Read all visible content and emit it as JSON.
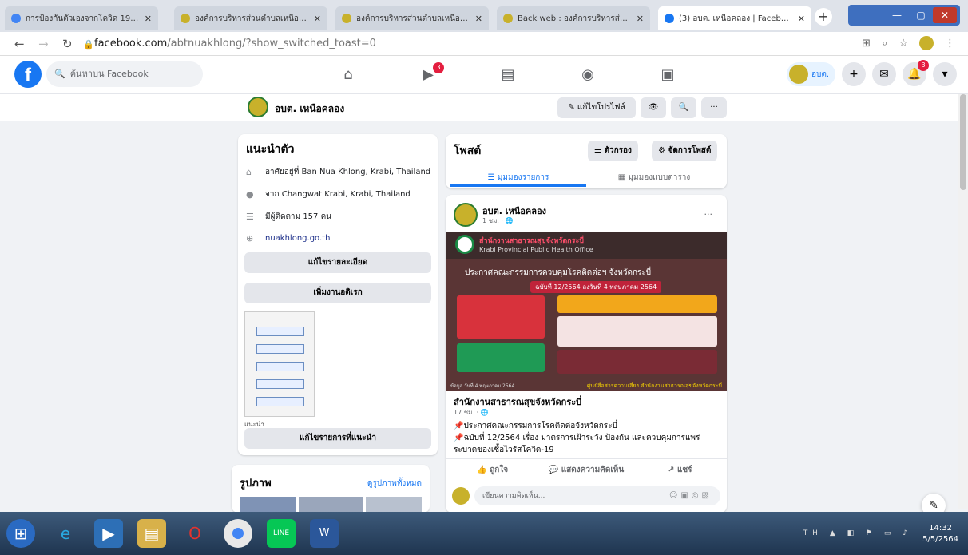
{
  "browser": {
    "tabs": [
      {
        "title": "การป้องกันตัวเองจากโควิด 19 - Go",
        "icon_color": "#4285f4"
      },
      {
        "title": "องค์การบริหารส่วนตำบลเหนือคลอง",
        "icon_color": "#c8b12b"
      },
      {
        "title": "องค์การบริหารส่วนตำบลเหนือคลอง",
        "icon_color": "#c8b12b"
      },
      {
        "title": "Back web : องค์การบริหารส่วนตำ",
        "icon_color": "#c8b12b"
      },
      {
        "title": "(3) อบต. เหนือคลอง | Facebook",
        "icon_color": "#1877f2"
      }
    ],
    "url_host": "facebook.com",
    "url_path": "/abtnuakhlong/?show_switched_toast=0"
  },
  "fb": {
    "search_placeholder": "ค้นหาบน Facebook",
    "nav_badge": "3",
    "account_name": "อบต.",
    "notif_badge": "3"
  },
  "page": {
    "name": "อบต. เหนือคลอง",
    "edit_profile": "แก้ไขโปรไฟล์"
  },
  "intro": {
    "title": "แนะนำตัว",
    "lives_in": "อาศัยอยู่ที่ Ban Nua Khlong, Krabi, Thailand",
    "from": "จาก Changwat Krabi, Krabi, Thailand",
    "followers": "มีผู้ติดตาม 157 คน",
    "website": "nuakhlong.go.th",
    "edit_details": "แก้ไขรายละเอียด",
    "add_hobbies": "เพิ่มงานอดิเรก",
    "featured_label": "แนะนำ",
    "edit_featured": "แก้ไขรายการที่แนะนำ"
  },
  "photos": {
    "title": "รูปภาพ",
    "see_all": "ดูรูปภาพทั้งหมด"
  },
  "posts": {
    "title": "โพสต์",
    "filter": "ตัวกรอง",
    "manage": "จัดการโพสต์",
    "list_view": "มุมมองรายการ",
    "grid_view": "มุมมองแบบตาราง"
  },
  "post": {
    "author": "อบต. เหนือคลอง",
    "time": "1 ชม. · 🌐",
    "poster_org_th": "สำนักงานสาธารณสุขจังหวัดกระบี่",
    "poster_org_en": "Krabi Provincial Public Health Office",
    "poster_headline": "ประกาศคณะกรรมการควบคุมโรคติดต่อฯ จังหวัดกระบี่",
    "poster_sub": "ฉบับที่ 12/2564 ลงวันที่ 4 พฤษภาคม 2564",
    "poster_date": "ข้อมูล วันที่ 4 พฤษภาคม 2564",
    "poster_footer": "ศูนย์สื่อสารความเสี่ยง สำนักงานสาธารณสุขจังหวัดกระบี่",
    "shared_from": "สำนักงานสาธารณสุขจังหวัดกระบี่",
    "shared_time": "17 ชม. · 🌐",
    "body_line1": "📌ประกาศคณะกรรมการโรคติดต่อจังหวัดกระบี่",
    "body_line2": "📌ฉบับที่ 12/2564 เรื่อง มาตรการเฝ้าระวัง ป้องกัน และควบคุมการแพร่ระบาดของเชื้อไวรัสโควิด-19",
    "like": "ถูกใจ",
    "comment": "แสดงความคิดเห็น",
    "share": "แชร์",
    "comment_placeholder": "เขียนความคิดเห็น..."
  },
  "taskbar": {
    "lang": "TH",
    "time": "14:32",
    "date": "5/5/2564"
  }
}
